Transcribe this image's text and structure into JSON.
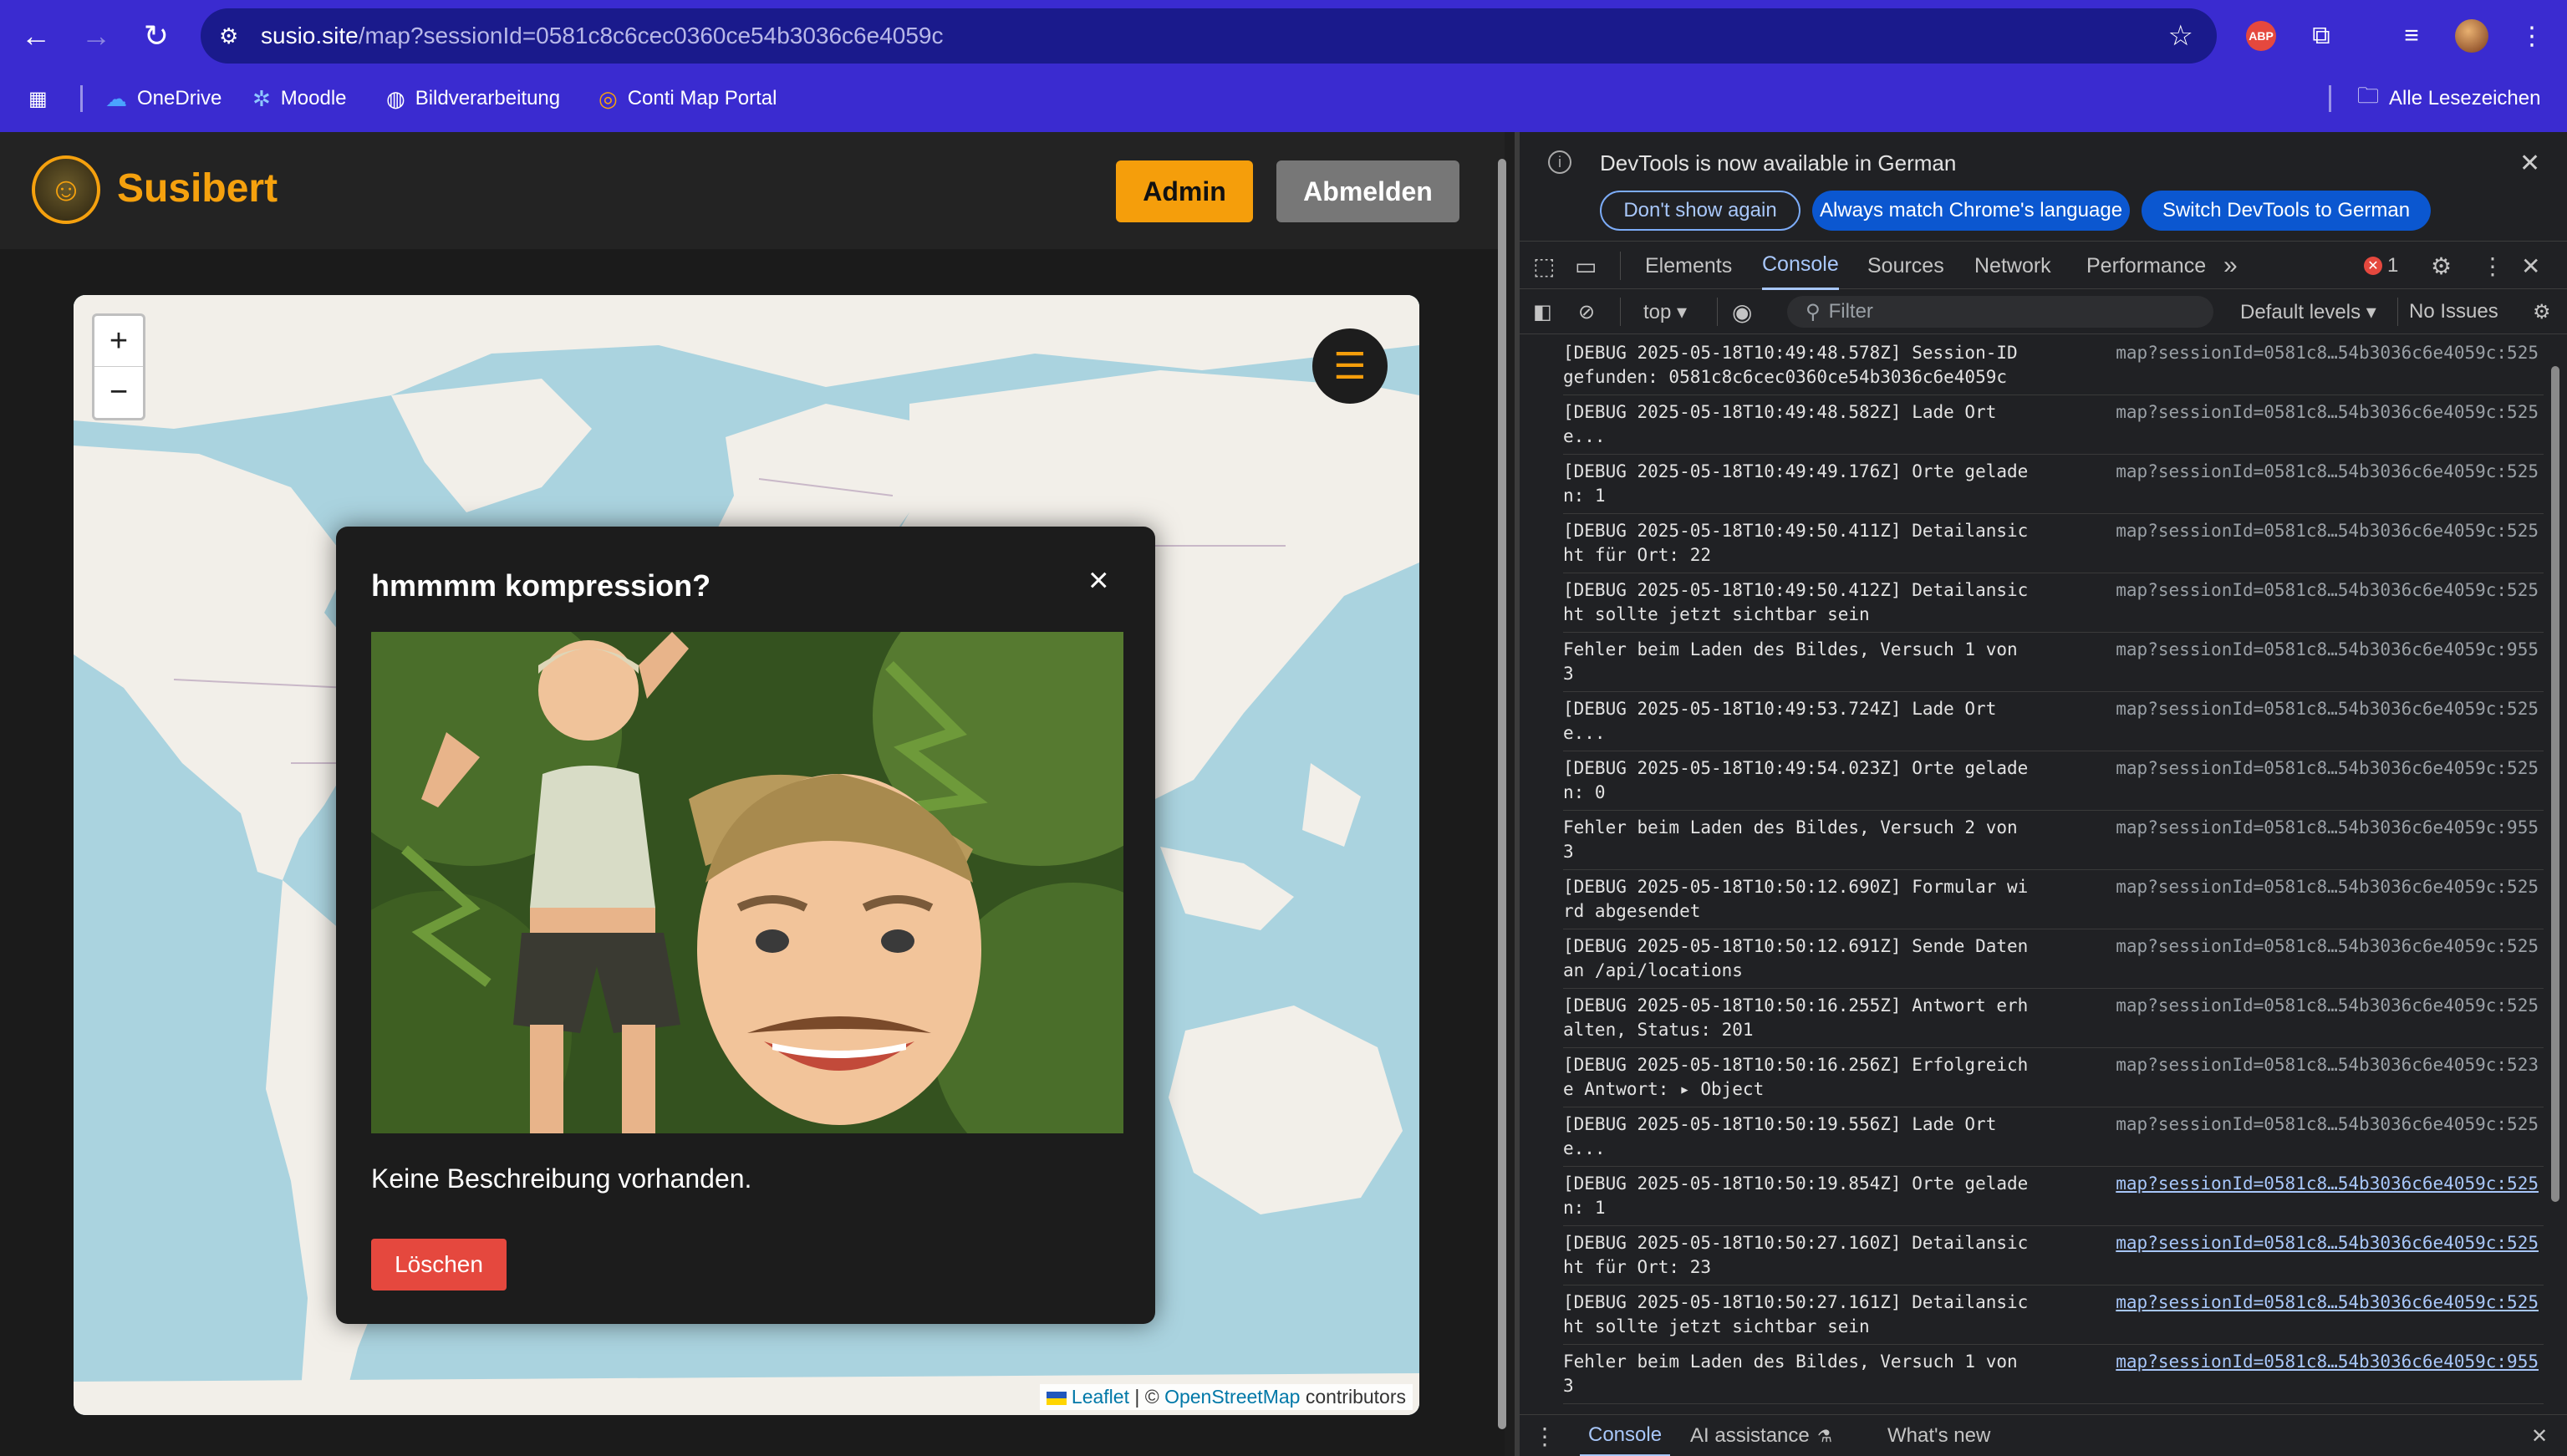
{
  "browser": {
    "url_host": "susio.site",
    "url_path": "/map?sessionId=0581c8c6cec0360ce54b3036c6e4059c",
    "bookmarks": [
      {
        "label": "OneDrive",
        "icon": "cloud-icon"
      },
      {
        "label": "Moodle",
        "icon": "moodle-icon"
      },
      {
        "label": "Bildverarbeitung",
        "icon": "globe-icon"
      },
      {
        "label": "Conti Map Portal",
        "icon": "portal-icon"
      }
    ],
    "all_bookmarks": "Alle Lesezeichen",
    "extension_abp": "ABP"
  },
  "site": {
    "brand": "Susibert",
    "admin_button": "Admin",
    "logout_button": "Abmelden",
    "accent_color": "#f59e0b"
  },
  "map": {
    "zoom_in": "+",
    "zoom_out": "−",
    "menu_icon": "hamburger-icon",
    "attribution_leaflet": "Leaflet",
    "attribution_sep": " | © ",
    "attribution_osm": "OpenStreetMap",
    "attribution_contrib": " contributors"
  },
  "modal": {
    "title": "hmmmm kompression?",
    "close": "×",
    "description": "Keine Beschreibung vorhanden.",
    "delete_button": "Löschen"
  },
  "devtools": {
    "notice": "DevTools is now available in German",
    "btn_dont_show": "Don't show again",
    "btn_match": "Always match Chrome's language",
    "btn_switch": "Switch DevTools to German",
    "tabs": [
      "Elements",
      "Console",
      "Sources",
      "Network",
      "Performance"
    ],
    "more_tabs": "»",
    "error_count": "1",
    "context": "top ▾",
    "filter_placeholder": "Filter",
    "levels": "Default levels ▾",
    "issues": "No Issues",
    "logs": [
      {
        "msg": "[DEBUG 2025-05-18T10:49:48.578Z] Session-ID gefunden: 0581c8c6cec0360ce54b3036c6e4059c",
        "src": "map?sessionId=0581c8…54b3036c6e4059c:525",
        "link": false
      },
      {
        "msg": "[DEBUG 2025-05-18T10:49:48.582Z] Lade Orte...",
        "src": "map?sessionId=0581c8…54b3036c6e4059c:525",
        "link": false
      },
      {
        "msg": "[DEBUG 2025-05-18T10:49:49.176Z] Orte geladen: 1",
        "src": "map?sessionId=0581c8…54b3036c6e4059c:525",
        "link": false
      },
      {
        "msg": "[DEBUG 2025-05-18T10:49:50.411Z] Detailansicht für Ort: 22",
        "src": "map?sessionId=0581c8…54b3036c6e4059c:525",
        "link": false
      },
      {
        "msg": "[DEBUG 2025-05-18T10:49:50.412Z] Detailansicht sollte jetzt sichtbar sein",
        "src": "map?sessionId=0581c8…54b3036c6e4059c:525",
        "link": false
      },
      {
        "msg": "Fehler beim Laden des Bildes, Versuch 1 von 3",
        "src": "map?sessionId=0581c8…54b3036c6e4059c:955",
        "link": false
      },
      {
        "msg": "[DEBUG 2025-05-18T10:49:53.724Z] Lade Orte...",
        "src": "map?sessionId=0581c8…54b3036c6e4059c:525",
        "link": false
      },
      {
        "msg": "[DEBUG 2025-05-18T10:49:54.023Z] Orte geladen: 0",
        "src": "map?sessionId=0581c8…54b3036c6e4059c:525",
        "link": false
      },
      {
        "msg": "Fehler beim Laden des Bildes, Versuch 2 von 3",
        "src": "map?sessionId=0581c8…54b3036c6e4059c:955",
        "link": false
      },
      {
        "msg": "[DEBUG 2025-05-18T10:50:12.690Z] Formular wird abgesendet",
        "src": "map?sessionId=0581c8…54b3036c6e4059c:525",
        "link": false
      },
      {
        "msg": "[DEBUG 2025-05-18T10:50:12.691Z] Sende Daten an /api/locations",
        "src": "map?sessionId=0581c8…54b3036c6e4059c:525",
        "link": false
      },
      {
        "msg": "[DEBUG 2025-05-18T10:50:16.255Z] Antwort erhalten, Status: 201",
        "src": "map?sessionId=0581c8…54b3036c6e4059c:525",
        "link": false
      },
      {
        "msg": "[DEBUG 2025-05-18T10:50:16.256Z] Erfolgreiche Antwort: ",
        "obj": "▸ Object",
        "src": "map?sessionId=0581c8…54b3036c6e4059c:523",
        "link": false
      },
      {
        "msg": "[DEBUG 2025-05-18T10:50:19.556Z] Lade Orte...",
        "src": "map?sessionId=0581c8…54b3036c6e4059c:525",
        "link": false
      },
      {
        "msg": "[DEBUG 2025-05-18T10:50:19.854Z] Orte geladen: 1",
        "src": "map?sessionId=0581c8…54b3036c6e4059c:525",
        "link": true
      },
      {
        "msg": "[DEBUG 2025-05-18T10:50:27.160Z] Detailansicht für Ort: 23",
        "src": "map?sessionId=0581c8…54b3036c6e4059c:525",
        "link": true
      },
      {
        "msg": "[DEBUG 2025-05-18T10:50:27.161Z] Detailansicht sollte jetzt sichtbar sein",
        "src": "map?sessionId=0581c8…54b3036c6e4059c:525",
        "link": true
      },
      {
        "msg": "Fehler beim Laden des Bildes, Versuch 1 von 3",
        "src": "map?sessionId=0581c8…54b3036c6e4059c:955",
        "link": true
      }
    ],
    "drawer_tabs": [
      "Console",
      "AI assistance",
      "What's new"
    ]
  }
}
